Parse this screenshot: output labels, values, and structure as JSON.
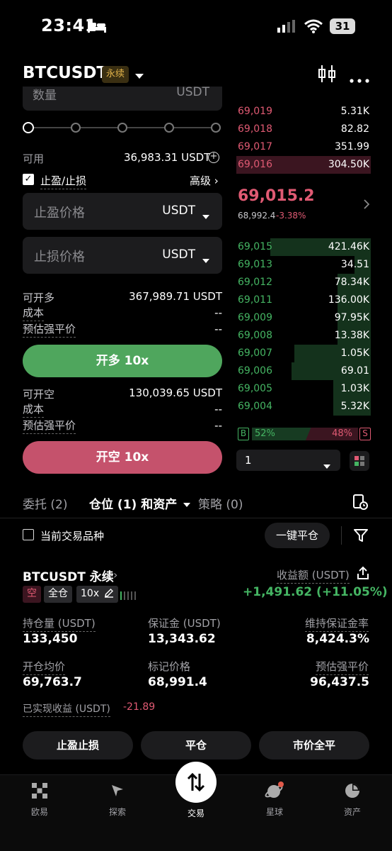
{
  "status": {
    "time": "23:41",
    "battery": "31"
  },
  "header": {
    "symbol": "BTCUSDT",
    "tag": "永续"
  },
  "form": {
    "qty_label": "数量",
    "qty_unit": "USDT",
    "available_label": "可用",
    "available_value": "36,983.31 USDT",
    "tpsl_label": "止盈/止损",
    "advanced_label": "高级 ›",
    "tp_placeholder": "止盈价格",
    "sl_placeholder": "止损价格",
    "unit": "USDT",
    "long": {
      "max_label": "可开多",
      "max_value": "367,989.71 USDT",
      "cost_label": "成本",
      "cost_value": "--",
      "liq_label": "预估强平价",
      "liq_value": "--",
      "button": "开多 10x"
    },
    "short": {
      "max_label": "可开空",
      "max_value": "130,039.65 USDT",
      "cost_label": "成本",
      "cost_value": "--",
      "liq_label": "预估强平价",
      "liq_value": "--",
      "button": "开空 10x"
    }
  },
  "orderbook": {
    "asks": [
      {
        "price": "69,019",
        "qty": "5.31K",
        "depth": 0.0
      },
      {
        "price": "69,018",
        "qty": "82.82",
        "depth": 0.0
      },
      {
        "price": "69,017",
        "qty": "351.99",
        "depth": 0.0
      },
      {
        "price": "69,016",
        "qty": "304.50K",
        "depth": 1.0
      }
    ],
    "last_price": "69,015.2",
    "mark_price": "68,992.4",
    "change": "-3.38%",
    "bids": [
      {
        "price": "69,015",
        "qty": "421.46K",
        "depth": 0.75
      },
      {
        "price": "69,013",
        "qty": "34.51",
        "depth": 0.12
      },
      {
        "price": "69,012",
        "qty": "78.34K",
        "depth": 0.25
      },
      {
        "price": "69,011",
        "qty": "136.00K",
        "depth": 0.25
      },
      {
        "price": "69,009",
        "qty": "97.95K",
        "depth": 0.25
      },
      {
        "price": "69,008",
        "qty": "13.38K",
        "depth": 0.25
      },
      {
        "price": "69,007",
        "qty": "1.05K",
        "depth": 0.57
      },
      {
        "price": "69,006",
        "qty": "69.01",
        "depth": 0.59
      },
      {
        "price": "69,005",
        "qty": "1.03K",
        "depth": 0.28
      },
      {
        "price": "69,004",
        "qty": "5.32K",
        "depth": 0.28
      }
    ],
    "buy_label": "B",
    "buy_pct": "52%",
    "sell_pct": "48%",
    "sell_label": "S",
    "depth_value": "1"
  },
  "tabs": {
    "orders": "委托 (2)",
    "positions": "仓位 (1) 和资产",
    "strategy": "策略 (0)"
  },
  "filters": {
    "current_only": "当前交易品种",
    "close_all": "一键平仓"
  },
  "position": {
    "symbol": "BTCUSDT 永续",
    "side": "空",
    "margin_mode": "全仓",
    "leverage": "10x",
    "pnl_label": "收益额 (USDT)",
    "pnl_value": "+1,491.62 (+11.05%)",
    "size_label": "持仓量 (USDT)",
    "size_value": "133,450",
    "margin_label": "保证金 (USDT)",
    "margin_value": "13,343.62",
    "mmr_label": "维持保证金率",
    "mmr_value": "8,424.3%",
    "entry_label": "开仓均价",
    "entry_value": "69,763.7",
    "mark_label": "标记价格",
    "mark_value": "68,991.4",
    "liq_label": "预估强平价",
    "liq_value": "96,437.5",
    "realized_label": "已实现收益 (USDT)",
    "realized_value": "-21.89",
    "btn_tpsl": "止盈止损",
    "btn_close": "平仓",
    "btn_market_close": "市价全平"
  },
  "nav": {
    "home": "欧易",
    "discover": "探索",
    "trade": "交易",
    "planet": "星球",
    "assets": "资产"
  },
  "colors": {
    "green": "#45b563",
    "red": "#e05a73",
    "long": "#4fa65d",
    "short": "#c5526c"
  }
}
